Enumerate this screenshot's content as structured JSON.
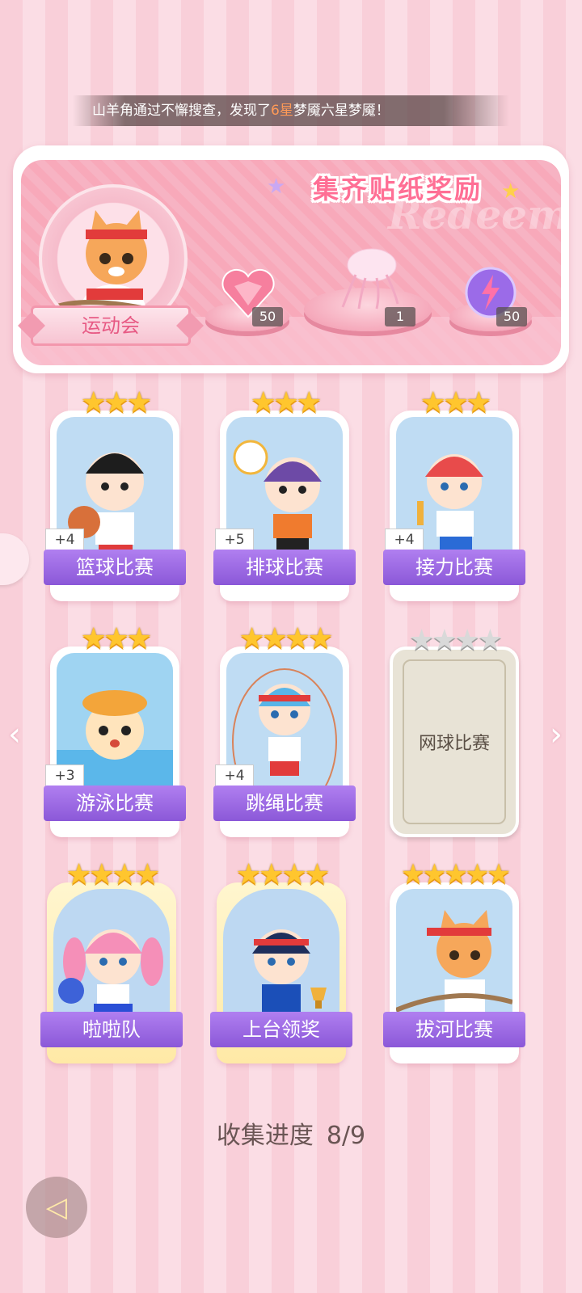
{
  "notice": {
    "prefix": "山羊角通过不懈搜查，发现了",
    "highlight": "6星",
    "suffix": "梦魇六星梦魇！"
  },
  "banner": {
    "title": "集齐贴纸奖励",
    "watermark": "Redeem",
    "event_name": "运动会",
    "rewards": [
      {
        "icon": "pink-heart-gem-icon",
        "count": "50"
      },
      {
        "icon": "jellyfish-trophy-icon",
        "count": "1"
      },
      {
        "icon": "purple-lightning-orb-icon",
        "count": "50"
      }
    ]
  },
  "cards": [
    {
      "name": "篮球比赛",
      "stars": 3,
      "bonus": "+4",
      "collected": true
    },
    {
      "name": "排球比赛",
      "stars": 3,
      "bonus": "+5",
      "collected": true
    },
    {
      "name": "接力比赛",
      "stars": 3,
      "bonus": "+4",
      "collected": true
    },
    {
      "name": "游泳比赛",
      "stars": 3,
      "bonus": "+3",
      "collected": true
    },
    {
      "name": "跳绳比赛",
      "stars": 4,
      "bonus": "+4",
      "collected": true
    },
    {
      "name": "网球比赛",
      "stars": 4,
      "bonus": "",
      "collected": false
    },
    {
      "name": "啦啦队",
      "stars": 4,
      "bonus": "",
      "collected": true
    },
    {
      "name": "上台领奖",
      "stars": 4,
      "bonus": "",
      "collected": true
    },
    {
      "name": "拔河比赛",
      "stars": 5,
      "bonus": "",
      "collected": true
    }
  ],
  "progress": {
    "label": "收集进度",
    "value": "8/9"
  },
  "nav": {
    "left_arrow": "‹",
    "right_arrow": "›",
    "back": "◁"
  }
}
